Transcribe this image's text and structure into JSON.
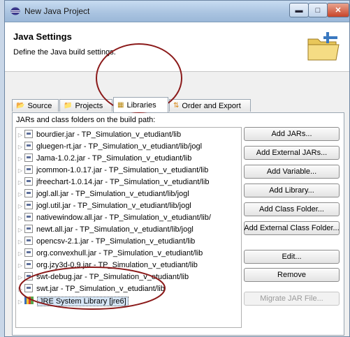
{
  "window": {
    "title": "New Java Project"
  },
  "header": {
    "title": "Java Settings",
    "subtitle": "Define the Java build settings."
  },
  "tabs": [
    {
      "label": "Source",
      "icon": "source-folder-icon"
    },
    {
      "label": "Projects",
      "icon": "projects-icon"
    },
    {
      "label": "Libraries",
      "icon": "libraries-icon",
      "active": true
    },
    {
      "label": "Order and Export",
      "icon": "order-export-icon"
    }
  ],
  "libraries": {
    "label": "JARs and class folders on the build path:",
    "entries": [
      "bourdier.jar - TP_Simulation_v_etudiant/lib",
      "gluegen-rt.jar - TP_Simulation_v_etudiant/lib/jogl",
      "Jama-1.0.2.jar - TP_Simulation_v_etudiant/lib",
      "jcommon-1.0.17.jar - TP_Simulation_v_etudiant/lib",
      "jfreechart-1.0.14.jar - TP_Simulation_v_etudiant/lib",
      "jogl.all.jar - TP_Simulation_v_etudiant/lib/jogl",
      "jogl.util.jar - TP_Simulation_v_etudiant/lib/jogl",
      "nativewindow.all.jar - TP_Simulation_v_etudiant/lib/",
      "newt.all.jar - TP_Simulation_v_etudiant/lib/jogl",
      "opencsv-2.1.jar - TP_Simulation_v_etudiant/lib",
      "org.convexhull.jar - TP_Simulation_v_etudiant/lib",
      "org.jzy3d-0.9.jar - TP_Simulation_v_etudiant/lib",
      "swt-debug.jar - TP_Simulation_v_etudiant/lib",
      "swt.jar - TP_Simulation_v_etudiant/lib"
    ],
    "system_library": "JRE System Library [jre6]"
  },
  "buttons": {
    "add_jars": "Add JARs...",
    "add_external_jars": "Add External JARs...",
    "add_variable": "Add Variable...",
    "add_library": "Add Library...",
    "add_class_folder": "Add Class Folder...",
    "add_external_class_folder": "Add External Class Folder...",
    "edit": "Edit...",
    "remove": "Remove",
    "migrate_jar": "Migrate JAR File..."
  },
  "colors": {
    "annotation_circle": "#8b1a1a",
    "selection": "#d6e6f7"
  }
}
